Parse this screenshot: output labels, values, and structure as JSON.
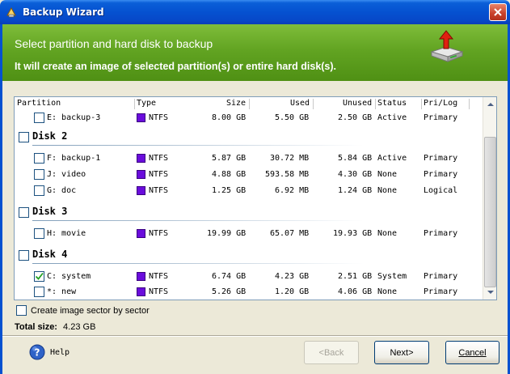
{
  "window": {
    "title": "Backup Wizard"
  },
  "header": {
    "title": "Select partition and hard disk to backup",
    "subtitle": "It will create an image of selected partition(s) or entire hard disk(s)."
  },
  "columns": [
    "Partition",
    "Type",
    "Size",
    "Used",
    "Unused",
    "Status",
    "Pri/Log"
  ],
  "rows": [
    {
      "kind": "partition",
      "checked": false,
      "name": "E: backup-3",
      "type": "NTFS",
      "size": "8.00 GB",
      "used": "5.50 GB",
      "unused": "2.50 GB",
      "status": "Active",
      "prilog": "Primary"
    },
    {
      "kind": "disk",
      "checked": false,
      "label": "Disk 2"
    },
    {
      "kind": "partition",
      "checked": false,
      "name": "F: backup-1",
      "type": "NTFS",
      "size": "5.87 GB",
      "used": "30.72 MB",
      "unused": "5.84 GB",
      "status": "Active",
      "prilog": "Primary"
    },
    {
      "kind": "partition",
      "checked": false,
      "name": "J: video",
      "type": "NTFS",
      "size": "4.88 GB",
      "used": "593.58 MB",
      "unused": "4.30 GB",
      "status": "None",
      "prilog": "Primary"
    },
    {
      "kind": "partition",
      "checked": false,
      "name": "G: doc",
      "type": "NTFS",
      "size": "1.25 GB",
      "used": "6.92 MB",
      "unused": "1.24 GB",
      "status": "None",
      "prilog": "Logical"
    },
    {
      "kind": "disk",
      "checked": false,
      "label": "Disk 3"
    },
    {
      "kind": "partition",
      "checked": false,
      "name": "H: movie",
      "type": "NTFS",
      "size": "19.99 GB",
      "used": "65.07 MB",
      "unused": "19.93 GB",
      "status": "None",
      "prilog": "Primary"
    },
    {
      "kind": "disk",
      "checked": false,
      "label": "Disk 4"
    },
    {
      "kind": "partition",
      "checked": true,
      "name": "C: system",
      "type": "NTFS",
      "size": "6.74 GB",
      "used": "4.23 GB",
      "unused": "2.51 GB",
      "status": "System",
      "prilog": "Primary"
    },
    {
      "kind": "partition",
      "checked": false,
      "name": "*: new",
      "type": "NTFS",
      "size": "5.26 GB",
      "used": "1.20 GB",
      "unused": "4.06 GB",
      "status": "None",
      "prilog": "Primary"
    }
  ],
  "colors": {
    "ntfs": "#6a0cdc",
    "header_green": "#62a422",
    "title_blue": "#0551d0"
  },
  "option": {
    "label": "Create image sector by sector",
    "checked": false
  },
  "total": {
    "label": "Total size:",
    "value": "4.23 GB"
  },
  "buttons": {
    "help": "Help",
    "back": "<Back",
    "next": "Next>",
    "cancel": "Cancel"
  },
  "icons": {
    "app": "wizard-app-icon",
    "header": "hard-disk-upload-icon",
    "help": "help-question-icon",
    "close": "close-icon"
  }
}
